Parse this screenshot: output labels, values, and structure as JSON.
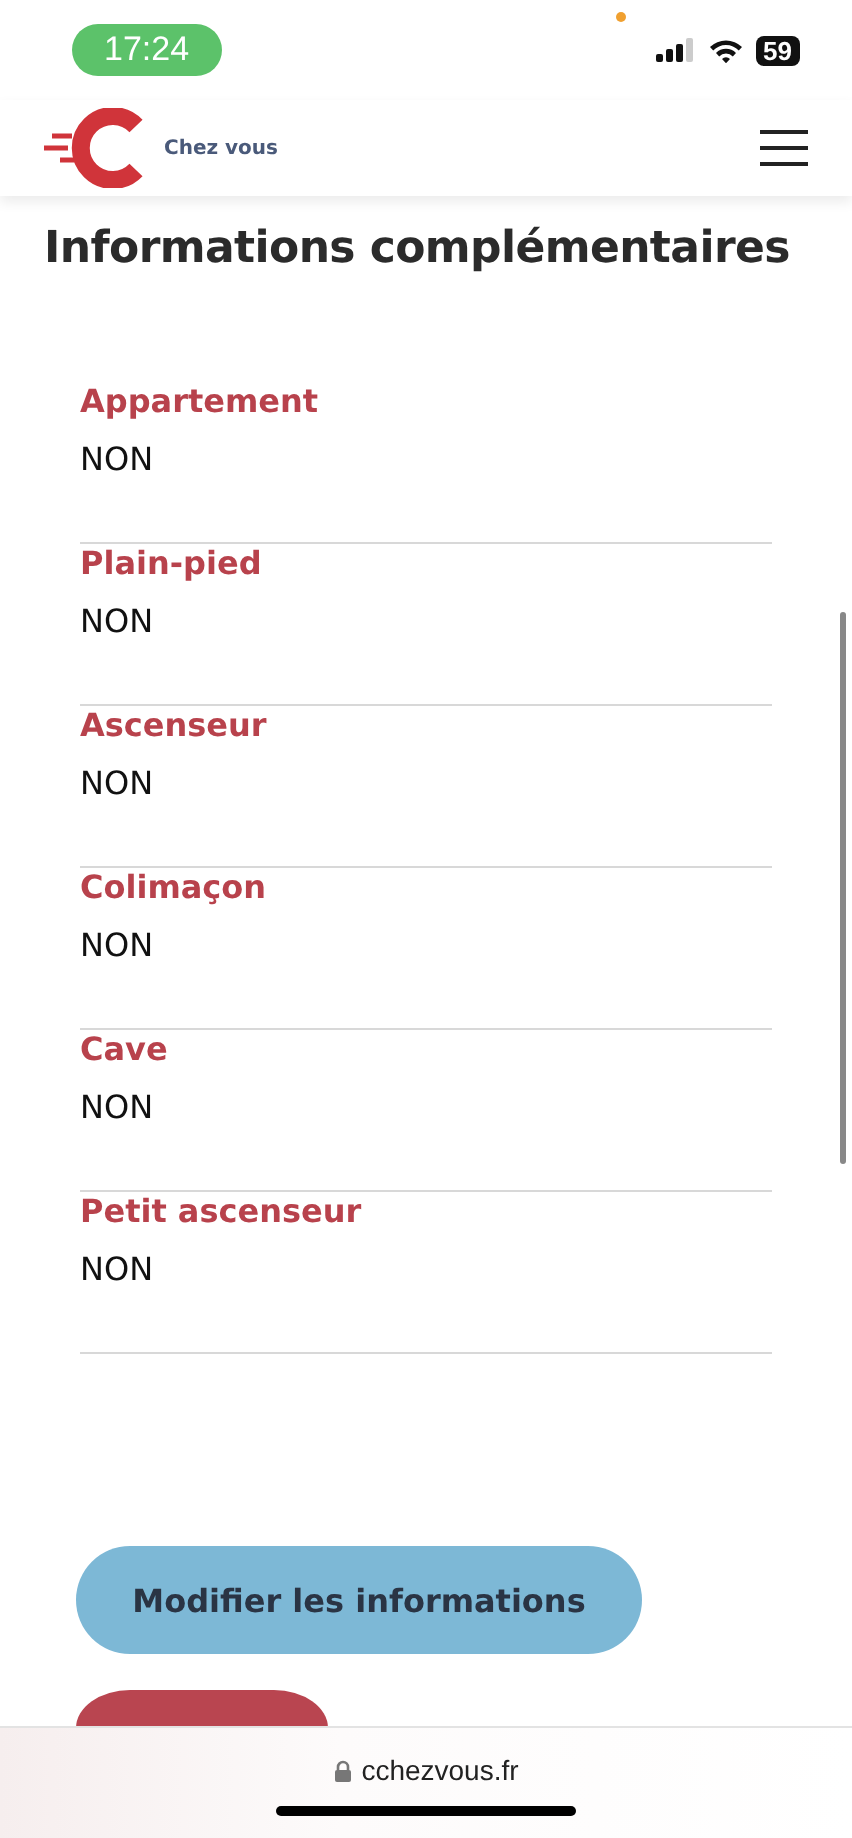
{
  "status_bar": {
    "time": "17:24",
    "battery": "59"
  },
  "header": {
    "brand": "Chez vous"
  },
  "title": "Informations complémentaires",
  "fields": [
    {
      "label": "Appartement",
      "value": "NON"
    },
    {
      "label": "Plain-pied",
      "value": "NON"
    },
    {
      "label": "Ascenseur",
      "value": "NON"
    },
    {
      "label": "Colimaçon",
      "value": "NON"
    },
    {
      "label": "Cave",
      "value": "NON"
    },
    {
      "label": "Petit ascenseur",
      "value": "NON"
    }
  ],
  "buttons": [
    {
      "label": "Modifier les informations",
      "kind": "primary"
    },
    {
      "kind": "danger"
    }
  ],
  "address_bar": {
    "url": "cchezvous.fr"
  }
}
